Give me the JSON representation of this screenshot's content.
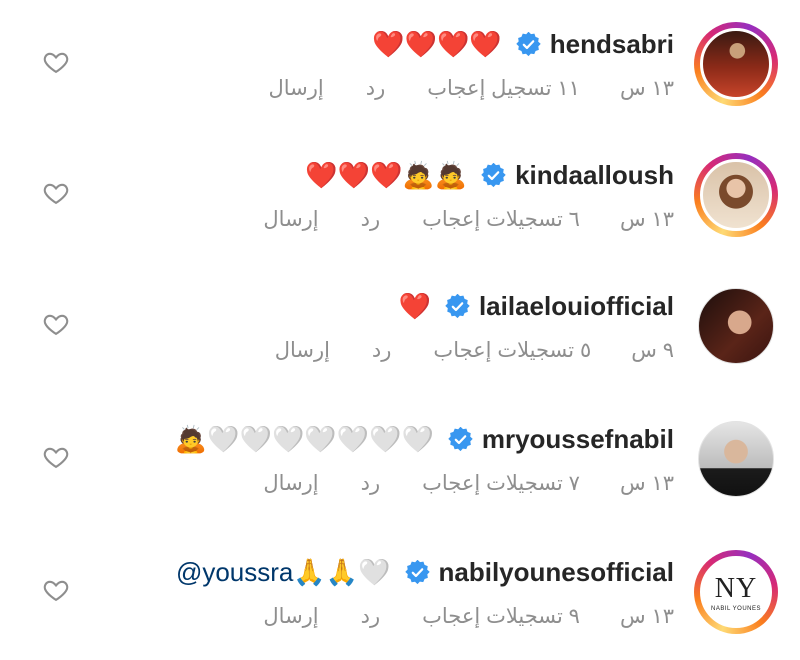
{
  "comments": [
    {
      "username": "hendsabri",
      "verified": true,
      "text": "❤️❤️❤️❤️",
      "time": "١٣ س",
      "likes": "١١ تسجيل إعجاب",
      "reply": "رد",
      "send": "إرسال",
      "story_ring": true,
      "avatar_icon": "profile-photo"
    },
    {
      "username": "kindaalloush",
      "verified": true,
      "text": "❤️❤️❤️🙇🙇",
      "time": "١٣ س",
      "likes": "٦ تسجيلات إعجاب",
      "reply": "رد",
      "send": "إرسال",
      "story_ring": true,
      "avatar_icon": "profile-photo"
    },
    {
      "username": "lailaelouiofficial",
      "verified": true,
      "text": "❤️",
      "time": "٩ س",
      "likes": "٥ تسجيلات إعجاب",
      "reply": "رد",
      "send": "إرسال",
      "story_ring": false,
      "avatar_icon": "profile-photo"
    },
    {
      "username": "mryoussefnabil",
      "verified": true,
      "text": "🙇🤍🤍🤍🤍🤍🤍🤍",
      "time": "١٣ س",
      "likes": "٧ تسجيلات إعجاب",
      "reply": "رد",
      "send": "إرسال",
      "story_ring": false,
      "avatar_icon": "profile-photo"
    },
    {
      "username": "nabilyounesofficial",
      "verified": true,
      "mention": "@youssra",
      "text": "🙏🙏🤍",
      "time": "١٣ س",
      "likes": "٩ تسجيلات إعجاب",
      "reply": "رد",
      "send": "إرسال",
      "story_ring": true,
      "avatar_icon": "ny-logo",
      "logo_text": "NY",
      "logo_sub": "NABIL YOUNES"
    }
  ],
  "icons": {
    "like": "heart-outline-icon",
    "verified": "verified-badge-icon"
  },
  "colors": {
    "verified_blue": "#3897f0",
    "meta_gray": "#8e8e8e",
    "mention_blue": "#00376b",
    "text": "#262626"
  }
}
